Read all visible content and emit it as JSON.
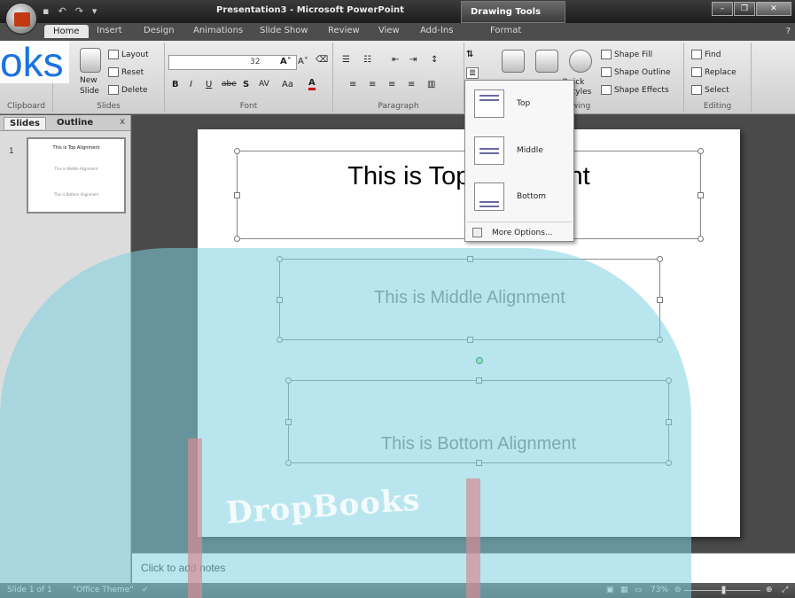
{
  "window": {
    "title": "Presentation3 - Microsoft PowerPoint",
    "context_tab": "Drawing Tools",
    "controls": [
      "–",
      "❐",
      "✕"
    ]
  },
  "tabs": [
    {
      "label": "Home",
      "active": true
    },
    {
      "label": "Insert"
    },
    {
      "label": "Design"
    },
    {
      "label": "Animations"
    },
    {
      "label": "Slide Show"
    },
    {
      "label": "Review"
    },
    {
      "label": "View"
    },
    {
      "label": "Add-Ins"
    },
    {
      "label": "Format"
    }
  ],
  "ribbon": {
    "clipboard_label": "Clipboard",
    "slides": {
      "layout": "Layout",
      "reset": "Reset",
      "delete": "Delete",
      "new": "New",
      "slide": "Slide",
      "group_label": "Slides"
    },
    "font": {
      "size": "32",
      "group_label": "Font",
      "bold": "B",
      "italic": "I",
      "underline": "U",
      "strike": "abe",
      "shadow": "S",
      "spacing": "AV",
      "case": "Aa",
      "color": "A"
    },
    "paragraph_label": "Paragraph",
    "drawing": {
      "shape_fill": "Shape Fill",
      "shape_outline": "Shape Outline",
      "shape_effects": "Shape Effects",
      "quick": "Quick",
      "styles": "Styles",
      "group_label": "Drawing"
    },
    "editing": {
      "find": "Find",
      "replace": "Replace",
      "select": "Select",
      "group_label": "Editing"
    }
  },
  "left_pane": {
    "tab_slides": "Slides",
    "tab_outline": "Outline",
    "close": "x",
    "thumb_number": "1",
    "thumb_title": "This is Top Alignment",
    "thumb_middle": "This is Middle Alignment",
    "thumb_bottom": "This is Bottom Alignment"
  },
  "slide": {
    "top_text": "This is Top Alignment",
    "middle_text": "This is Middle Alignment",
    "bottom_text": "This is Bottom Alignment"
  },
  "dropdown": {
    "items": [
      {
        "label": "Top"
      },
      {
        "label": "Middle"
      },
      {
        "label": "Bottom"
      }
    ],
    "more": "More Options..."
  },
  "notes": {
    "placeholder": "Click to add notes"
  },
  "status": {
    "slide_info": "Slide 1 of 1",
    "theme": "\"Office Theme\"",
    "zoom": "73%"
  },
  "watermark": {
    "big": "oks",
    "brand": "DropBooks"
  }
}
